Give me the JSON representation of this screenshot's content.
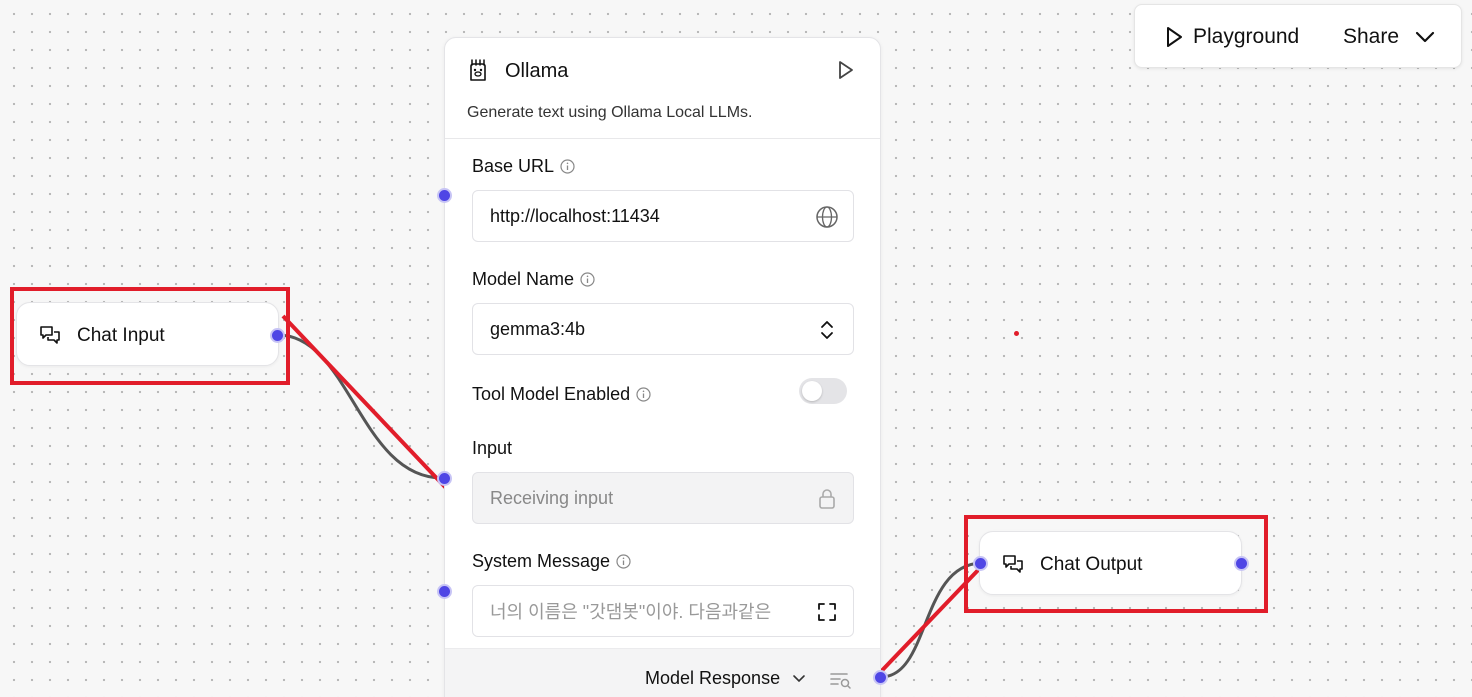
{
  "toolbar": {
    "playground_label": "Playground",
    "share_label": "Share"
  },
  "ollama": {
    "title": "Ollama",
    "description": "Generate text using Ollama Local LLMs.",
    "fields": {
      "base_url": {
        "label": "Base URL",
        "value": "http://localhost:11434"
      },
      "model_name": {
        "label": "Model Name",
        "value": "gemma3:4b"
      },
      "tool_model": {
        "label": "Tool Model Enabled",
        "enabled": false
      },
      "input": {
        "label": "Input",
        "placeholder": "Receiving input"
      },
      "system_message": {
        "label": "System Message",
        "value": "너의 이름은 \"갓댐봇\"이야. 다음과같은"
      }
    },
    "output": {
      "label": "Model Response"
    }
  },
  "chat_input": {
    "label": "Chat Input"
  },
  "chat_output": {
    "label": "Chat Output"
  },
  "colors": {
    "handle": "#4f46e5",
    "edge": "#555555",
    "annotation": "#e11d2a"
  },
  "icons": [
    "play-icon",
    "chevron-down-icon",
    "llama-icon",
    "info-icon",
    "globe-icon",
    "chevron-updown-icon",
    "lock-icon",
    "expand-icon",
    "inspect-icon",
    "chat-bubbles-icon"
  ]
}
